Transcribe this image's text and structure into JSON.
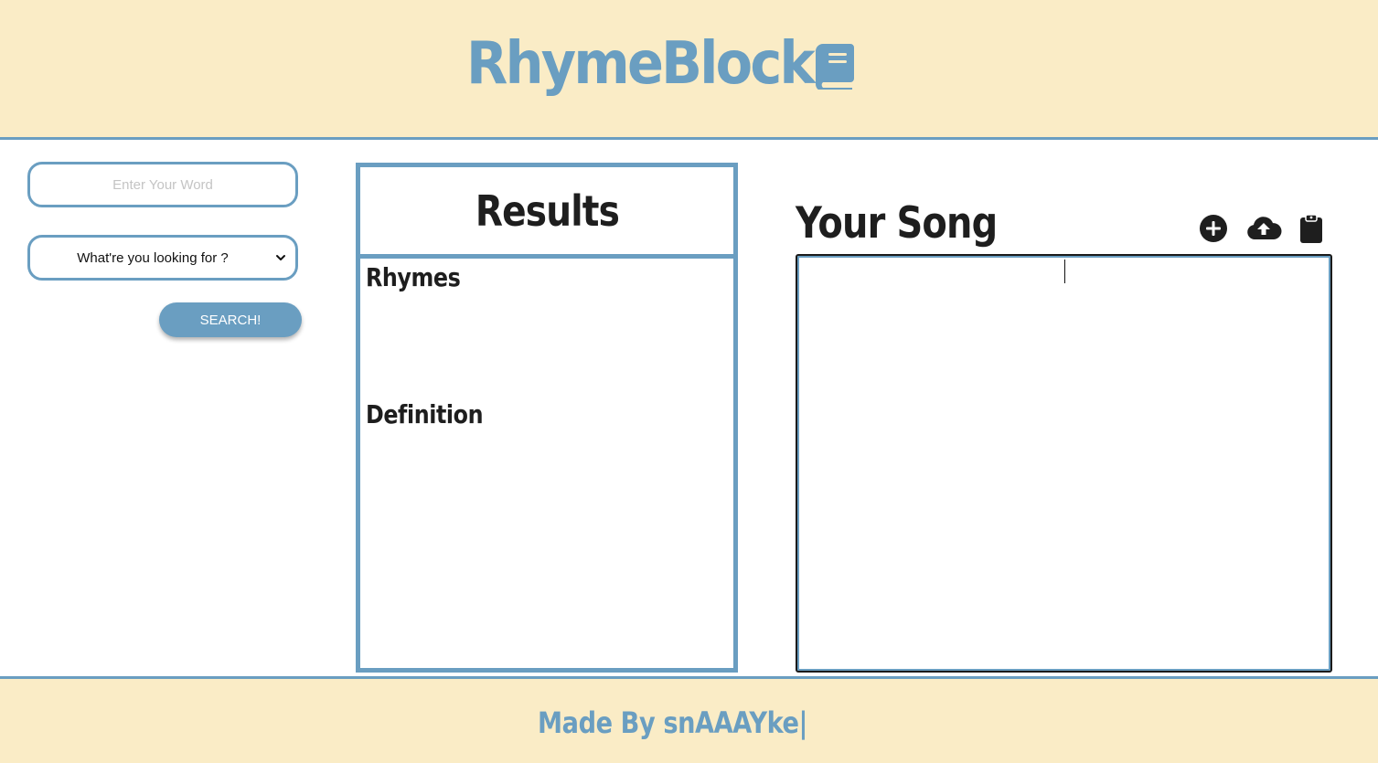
{
  "header": {
    "title": "RhymeBlock",
    "icon": "book-icon"
  },
  "search": {
    "word_placeholder": "Enter Your Word",
    "word_value": "",
    "type_selected": "What're you looking for ?",
    "button_label": "SEARCH!"
  },
  "results": {
    "title": "Results",
    "rhymes_heading": "Rhymes",
    "definition_heading": "Definition"
  },
  "song": {
    "title": "Your Song",
    "toolbar": [
      "plus-circle-icon",
      "cloud-upload-icon",
      "clipboard-icon"
    ],
    "content": ""
  },
  "footer": {
    "text": "Made By snAAAYke|"
  },
  "colors": {
    "accent": "#6a9ec1",
    "cream": "#faecc6",
    "text": "#1e1e1e"
  }
}
